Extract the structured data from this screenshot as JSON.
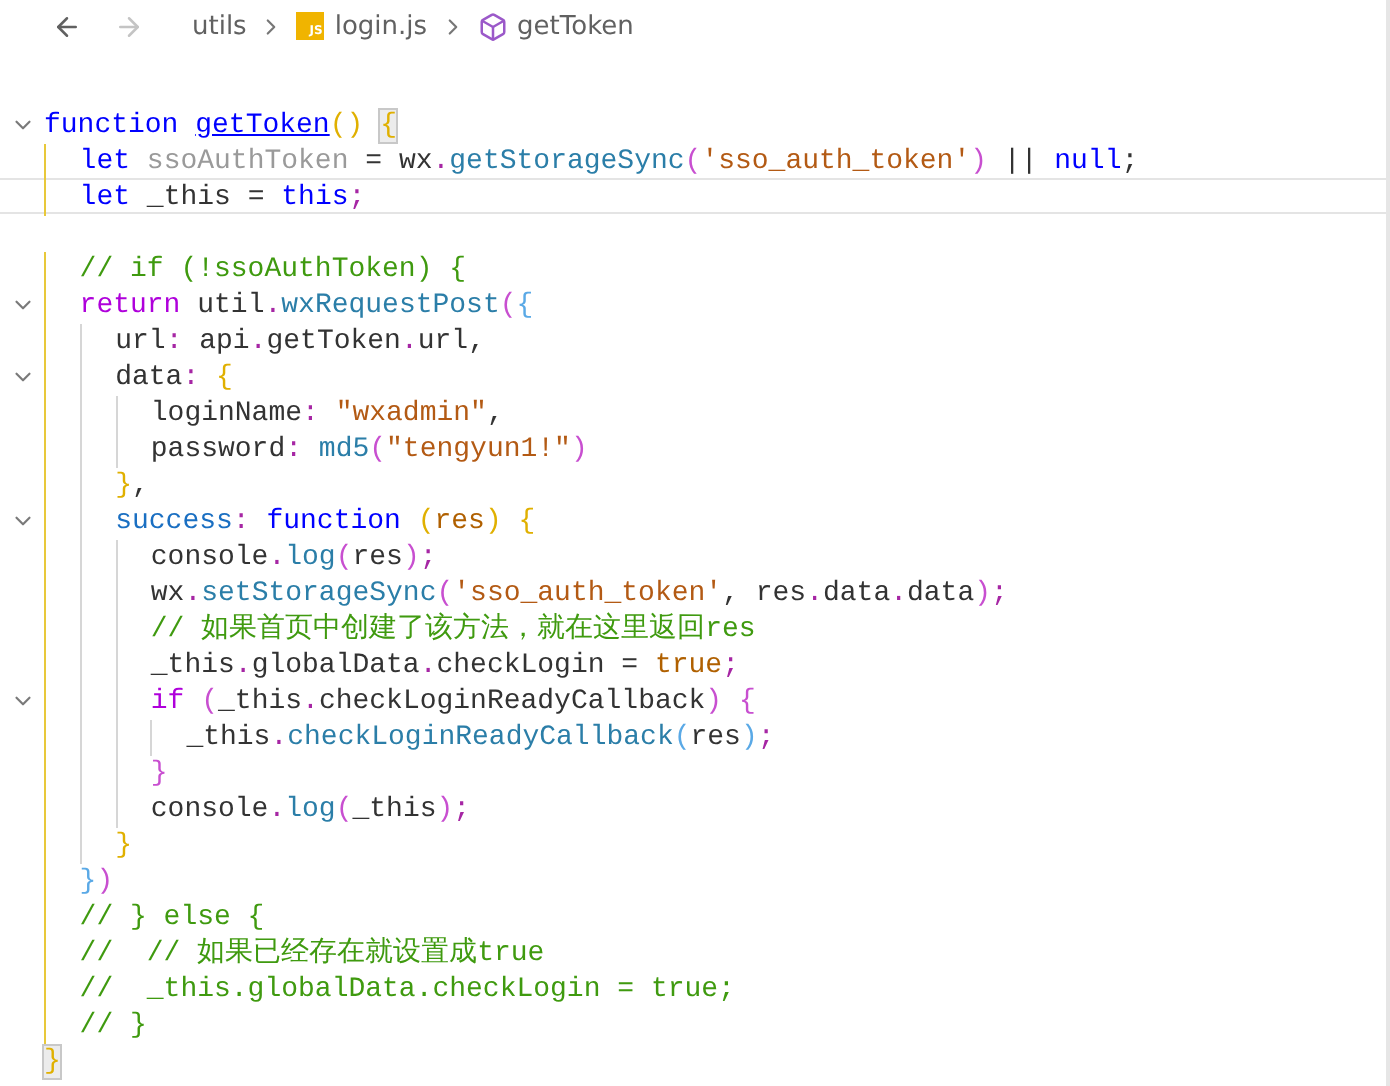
{
  "breadcrumb": {
    "nav": [
      {
        "kind": "back",
        "disabled": false
      },
      {
        "kind": "forward",
        "disabled": true
      }
    ],
    "path": [
      {
        "kind": "folder",
        "label": "utils"
      },
      {
        "kind": "file",
        "label": "login.js",
        "badge": "JS"
      },
      {
        "kind": "symbol",
        "label": "getToken"
      }
    ]
  },
  "lines": [
    {
      "fold": false,
      "current": false
    },
    {
      "fold": true,
      "current": false,
      "tokens": [
        {
          "kind": "storage",
          "text": "function "
        },
        {
          "kind": "def",
          "text": "getToken"
        },
        {
          "kind": "b1",
          "text": "() "
        },
        {
          "kind": "match",
          "text": "{"
        }
      ]
    },
    {
      "fold": false,
      "current": false,
      "tokens": [
        {
          "kind": "storage",
          "text": "  let"
        },
        {
          "kind": "unused",
          "text": " ssoAuthToken "
        },
        {
          "kind": "op",
          "text": "= wx"
        },
        {
          "kind": "dot",
          "text": "."
        },
        {
          "kind": "fn",
          "text": "getStorageSync"
        },
        {
          "kind": "b2",
          "text": "("
        },
        {
          "kind": "str",
          "text": "'sso_auth_token'"
        },
        {
          "kind": "b2",
          "text": ")"
        },
        {
          "kind": "op",
          "text": " || "
        },
        {
          "kind": "storage",
          "text": "null"
        },
        {
          "kind": "op",
          "text": ";"
        }
      ]
    },
    {
      "fold": false,
      "current": true,
      "tokens": [
        {
          "kind": "storage",
          "text": "  let"
        },
        {
          "kind": "var",
          "text": " _this = "
        },
        {
          "kind": "storage",
          "text": "this"
        },
        {
          "kind": "dot",
          "text": ";"
        }
      ]
    },
    {
      "fold": false,
      "current": false
    },
    {
      "fold": false,
      "current": false,
      "tokens": [
        {
          "kind": "comment",
          "text": "  // if (!ssoAuthToken) {"
        }
      ]
    },
    {
      "fold": true,
      "current": false,
      "tokens": [
        {
          "kind": "kw",
          "text": "  return"
        },
        {
          "kind": "var",
          "text": " util"
        },
        {
          "kind": "dot",
          "text": "."
        },
        {
          "kind": "fn",
          "text": "wxRequestPost"
        },
        {
          "kind": "b2",
          "text": "("
        },
        {
          "kind": "b3",
          "text": "{"
        }
      ]
    },
    {
      "fold": false,
      "current": false,
      "tokens": [
        {
          "kind": "prop",
          "text": "    url"
        },
        {
          "kind": "dot",
          "text": ":"
        },
        {
          "kind": "var",
          "text": " api"
        },
        {
          "kind": "dot",
          "text": "."
        },
        {
          "kind": "var",
          "text": "getToken"
        },
        {
          "kind": "dot",
          "text": "."
        },
        {
          "kind": "var",
          "text": "url"
        },
        {
          "kind": "op",
          "text": ","
        }
      ]
    },
    {
      "fold": true,
      "current": false,
      "tokens": [
        {
          "kind": "prop",
          "text": "    data"
        },
        {
          "kind": "dot",
          "text": ":"
        },
        {
          "kind": "b1",
          "text": " {"
        }
      ]
    },
    {
      "fold": false,
      "current": false,
      "tokens": [
        {
          "kind": "prop",
          "text": "      loginName"
        },
        {
          "kind": "dot",
          "text": ":"
        },
        {
          "kind": "str",
          "text": " \"wxadmin\""
        },
        {
          "kind": "op",
          "text": ","
        }
      ]
    },
    {
      "fold": false,
      "current": false,
      "tokens": [
        {
          "kind": "prop",
          "text": "      password"
        },
        {
          "kind": "dot",
          "text": ":"
        },
        {
          "kind": "fn",
          "text": " md5"
        },
        {
          "kind": "b2",
          "text": "("
        },
        {
          "kind": "str",
          "text": "\"tengyun1!\""
        },
        {
          "kind": "b2",
          "text": ")"
        }
      ]
    },
    {
      "fold": false,
      "current": false,
      "tokens": [
        {
          "kind": "b1",
          "text": "    }"
        },
        {
          "kind": "op",
          "text": ","
        }
      ]
    },
    {
      "fold": true,
      "current": false,
      "tokens": [
        {
          "kind": "key",
          "text": "    success"
        },
        {
          "kind": "dot",
          "text": ":"
        },
        {
          "kind": "storage",
          "text": " function "
        },
        {
          "kind": "b1",
          "text": "("
        },
        {
          "kind": "param",
          "text": "res"
        },
        {
          "kind": "b1",
          "text": ") {"
        }
      ]
    },
    {
      "fold": false,
      "current": false,
      "tokens": [
        {
          "kind": "var",
          "text": "      console"
        },
        {
          "kind": "dot",
          "text": "."
        },
        {
          "kind": "fn",
          "text": "log"
        },
        {
          "kind": "b2",
          "text": "("
        },
        {
          "kind": "var",
          "text": "res"
        },
        {
          "kind": "b2",
          "text": ")"
        },
        {
          "kind": "dot",
          "text": ";"
        }
      ]
    },
    {
      "fold": false,
      "current": false,
      "tokens": [
        {
          "kind": "var",
          "text": "      wx"
        },
        {
          "kind": "dot",
          "text": "."
        },
        {
          "kind": "fn",
          "text": "setStorageSync"
        },
        {
          "kind": "b2",
          "text": "("
        },
        {
          "kind": "str",
          "text": "'sso_auth_token'"
        },
        {
          "kind": "op",
          "text": ", res"
        },
        {
          "kind": "dot",
          "text": "."
        },
        {
          "kind": "var",
          "text": "data"
        },
        {
          "kind": "dot",
          "text": "."
        },
        {
          "kind": "var",
          "text": "data"
        },
        {
          "kind": "b2",
          "text": ")"
        },
        {
          "kind": "dot",
          "text": ";"
        }
      ]
    },
    {
      "fold": false,
      "current": false,
      "tokens": [
        {
          "kind": "comment",
          "text": "      // 如果首页中创建了该方法，就在这里返回res"
        }
      ]
    },
    {
      "fold": false,
      "current": false,
      "tokens": [
        {
          "kind": "var",
          "text": "      _this"
        },
        {
          "kind": "dot",
          "text": "."
        },
        {
          "kind": "var",
          "text": "globalData"
        },
        {
          "kind": "dot",
          "text": "."
        },
        {
          "kind": "var",
          "text": "checkLogin = "
        },
        {
          "kind": "const",
          "text": "true"
        },
        {
          "kind": "dot",
          "text": ";"
        }
      ]
    },
    {
      "fold": true,
      "current": false,
      "tokens": [
        {
          "kind": "kw",
          "text": "      if"
        },
        {
          "kind": "b2",
          "text": " ("
        },
        {
          "kind": "var",
          "text": "_this"
        },
        {
          "kind": "dot",
          "text": "."
        },
        {
          "kind": "var",
          "text": "checkLoginReadyCallback"
        },
        {
          "kind": "b2",
          "text": ") {"
        }
      ]
    },
    {
      "fold": false,
      "current": false,
      "tokens": [
        {
          "kind": "var",
          "text": "        _this"
        },
        {
          "kind": "dot",
          "text": "."
        },
        {
          "kind": "fn",
          "text": "checkLoginReadyCallback"
        },
        {
          "kind": "b3",
          "text": "("
        },
        {
          "kind": "var",
          "text": "res"
        },
        {
          "kind": "b3",
          "text": ")"
        },
        {
          "kind": "dot",
          "text": ";"
        }
      ]
    },
    {
      "fold": false,
      "current": false,
      "tokens": [
        {
          "kind": "b2",
          "text": "      }"
        }
      ]
    },
    {
      "fold": false,
      "current": false,
      "tokens": [
        {
          "kind": "var",
          "text": "      console"
        },
        {
          "kind": "dot",
          "text": "."
        },
        {
          "kind": "fn",
          "text": "log"
        },
        {
          "kind": "b2",
          "text": "("
        },
        {
          "kind": "var",
          "text": "_this"
        },
        {
          "kind": "b2",
          "text": ")"
        },
        {
          "kind": "dot",
          "text": ";"
        }
      ]
    },
    {
      "fold": false,
      "current": false,
      "tokens": [
        {
          "kind": "b1",
          "text": "    }"
        }
      ]
    },
    {
      "fold": false,
      "current": false,
      "tokens": [
        {
          "kind": "b3",
          "text": "  }"
        },
        {
          "kind": "b2",
          "text": ")"
        }
      ]
    },
    {
      "fold": false,
      "current": false,
      "tokens": [
        {
          "kind": "comment",
          "text": "  // } else {"
        }
      ]
    },
    {
      "fold": false,
      "current": false,
      "tokens": [
        {
          "kind": "comment",
          "text": "  //  // 如果已经存在就设置成true"
        }
      ]
    },
    {
      "fold": false,
      "current": false,
      "tokens": [
        {
          "kind": "comment",
          "text": "  //  _this.globalData.checkLogin = true;"
        }
      ]
    },
    {
      "fold": false,
      "current": false,
      "tokens": [
        {
          "kind": "comment",
          "text": "  // }"
        }
      ]
    },
    {
      "fold": false,
      "current": false,
      "tokens": [
        {
          "kind": "match",
          "text": "}"
        }
      ]
    }
  ]
}
